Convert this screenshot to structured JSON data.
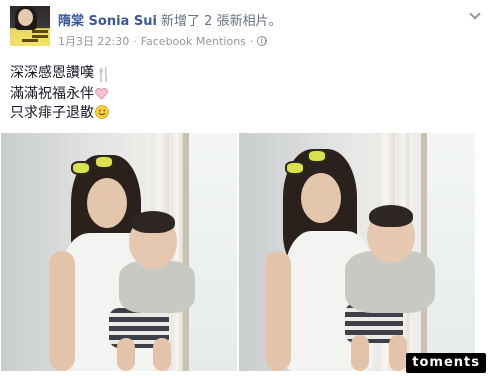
{
  "post": {
    "author": "隋棠 Sonia Sui",
    "action": " 新增了 2 張新相片。",
    "date": "1月3日 22:30",
    "separator": "·",
    "app": "Facebook Mentions",
    "separator2": "·",
    "privacy_icon": "globe-icon",
    "menu_icon": "chevron-down-icon",
    "text_lines": [
      "深深感恩讚嘆",
      "滿滿祝福永伴",
      "只求痱子退散"
    ],
    "line_emojis": [
      "🍴",
      "🤍",
      "😊"
    ],
    "photos": [
      "photo-1",
      "photo-2"
    ]
  },
  "watermark": "toments"
}
